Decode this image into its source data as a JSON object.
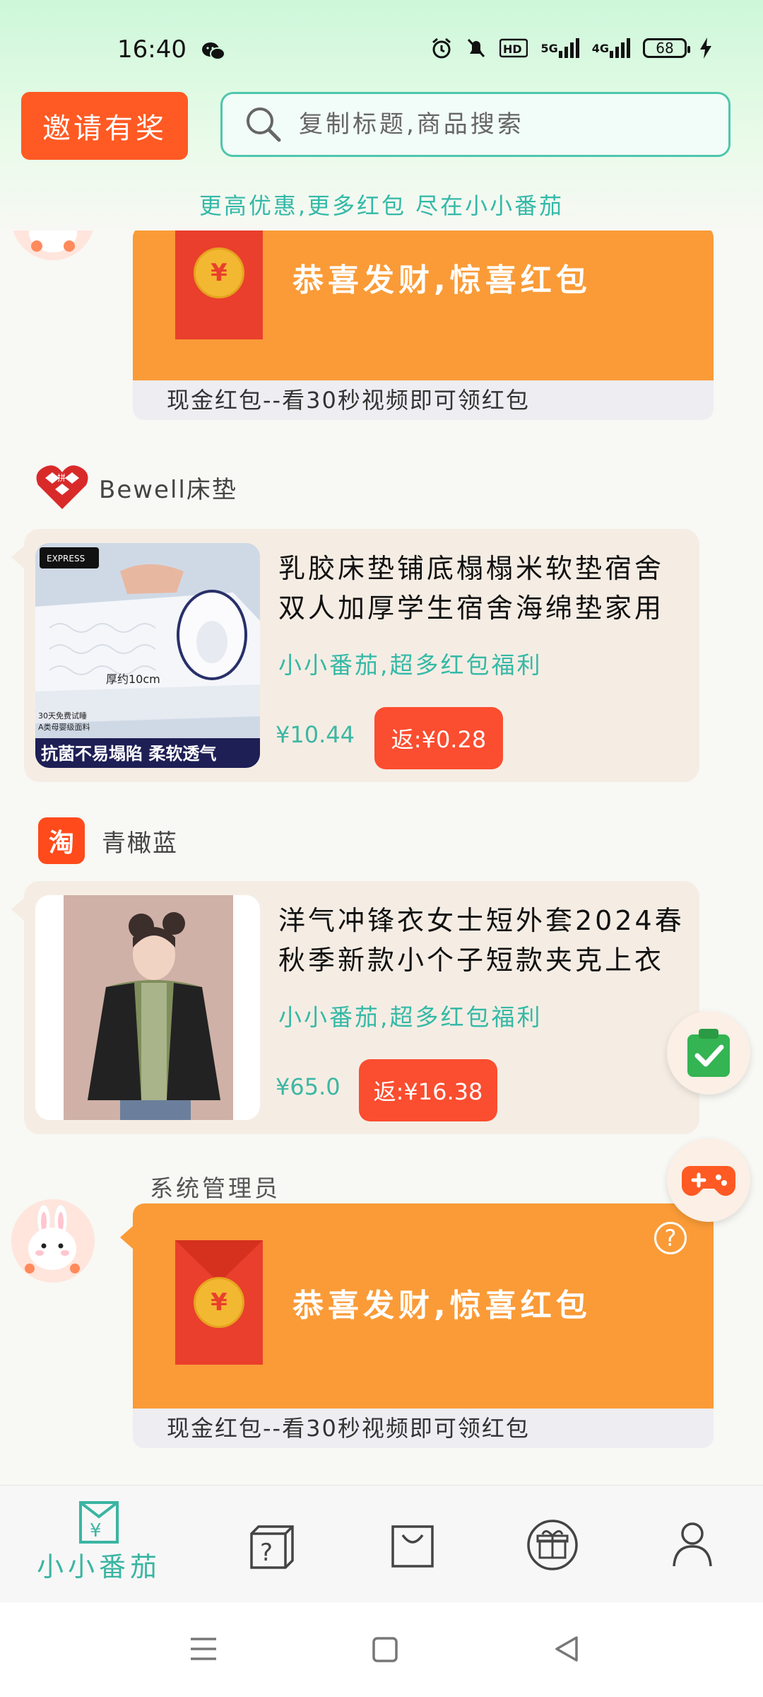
{
  "status_bar": {
    "time": "16:40",
    "network": "5G",
    "network2": "4G",
    "battery": "68"
  },
  "header": {
    "invite_label": "邀请有奖",
    "search_placeholder": "复制标题,商品搜索",
    "slogan": "更高优惠,更多红包 尽在小小番茄"
  },
  "feed": {
    "red_packet_top": {
      "title": "恭喜发财,惊喜红包",
      "subtitle": "现金红包--看30秒视频即可领红包",
      "coin": "¥"
    },
    "products": [
      {
        "store": "Bewell床垫",
        "title": "乳胶床垫铺底榻榻米软垫宿舍双人加厚学生宿舍海绵垫家用",
        "tag": "小小番茄,超多红包福利",
        "price": "¥10.44",
        "rebate": "返:¥0.28",
        "image_texts": {
          "express": "EXPRESS",
          "thickness": "厚约10cm",
          "trial": "30天免费试睡",
          "grade": "A类母婴级面料",
          "banner": "抗菌不易塌陷  柔软透气"
        }
      },
      {
        "store": "青橄蓝",
        "store_logo": "淘",
        "title": "洋气冲锋衣女士短外套2024春秋季新款小个子短款夹克上衣",
        "tag": "小小番茄,超多红包福利",
        "price": "¥65.0",
        "rebate": "返:¥16.38"
      }
    ],
    "admin": {
      "label": "系统管理员",
      "red_packet": {
        "title": "恭喜发财,惊喜红包",
        "subtitle": "现金红包--看30秒视频即可领红包",
        "coin": "¥",
        "help": "?"
      }
    }
  },
  "bottom_nav": {
    "home_label": "小小番茄"
  },
  "colors": {
    "accent": "#3ab5a2",
    "orange": "#fa9b37",
    "red": "#fb4d2f",
    "invite": "#ff5a23"
  }
}
